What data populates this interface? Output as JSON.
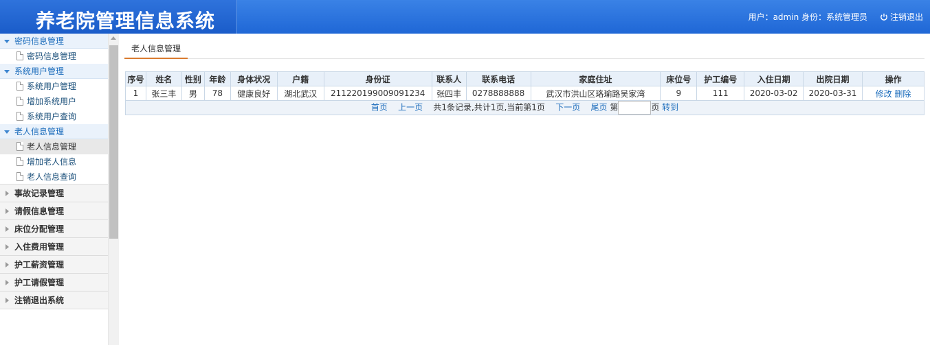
{
  "header": {
    "title": "养老院管理信息系统",
    "user_info": "用户：admin 身份：系统管理员",
    "logout_label": "注销退出"
  },
  "sidebar": {
    "groups_open": [
      {
        "title": "密码信息管理",
        "items": [
          "密码信息管理"
        ]
      },
      {
        "title": "系统用户管理",
        "items": [
          "系统用户管理",
          "增加系统用户",
          "系统用户查询"
        ]
      },
      {
        "title": "老人信息管理",
        "items": [
          "老人信息管理",
          "增加老人信息",
          "老人信息查询"
        ]
      }
    ],
    "groups_closed": [
      "事故记录管理",
      "请假信息管理",
      "床位分配管理",
      "入住费用管理",
      "护工薪资管理",
      "护工请假管理",
      "注销退出系统"
    ]
  },
  "main": {
    "tab": "老人信息管理",
    "table": {
      "headers": [
        "序号",
        "姓名",
        "性别",
        "年龄",
        "身体状况",
        "户籍",
        "身份证",
        "联系人",
        "联系电话",
        "家庭住址",
        "床位号",
        "护工编号",
        "入住日期",
        "出院日期",
        "操作"
      ],
      "rows": [
        [
          "1",
          "张三丰",
          "男",
          "78",
          "健康良好",
          "湖北武汉",
          "211220199009091234",
          "张四丰",
          "0278888888",
          "武汉市洪山区珞瑜路吴家湾",
          "9",
          "111",
          "2020-03-02",
          "2020-03-31"
        ]
      ],
      "row_actions": {
        "edit": "修改",
        "delete": "删除"
      }
    },
    "pager": {
      "first": "首页",
      "prev": "上一页",
      "summary": "共1条记录,共计1页,当前第1页",
      "next": "下一页",
      "last": "尾页",
      "page_prefix": "第",
      "page_suffix": "页",
      "goto": "转到",
      "page_input_value": ""
    }
  }
}
